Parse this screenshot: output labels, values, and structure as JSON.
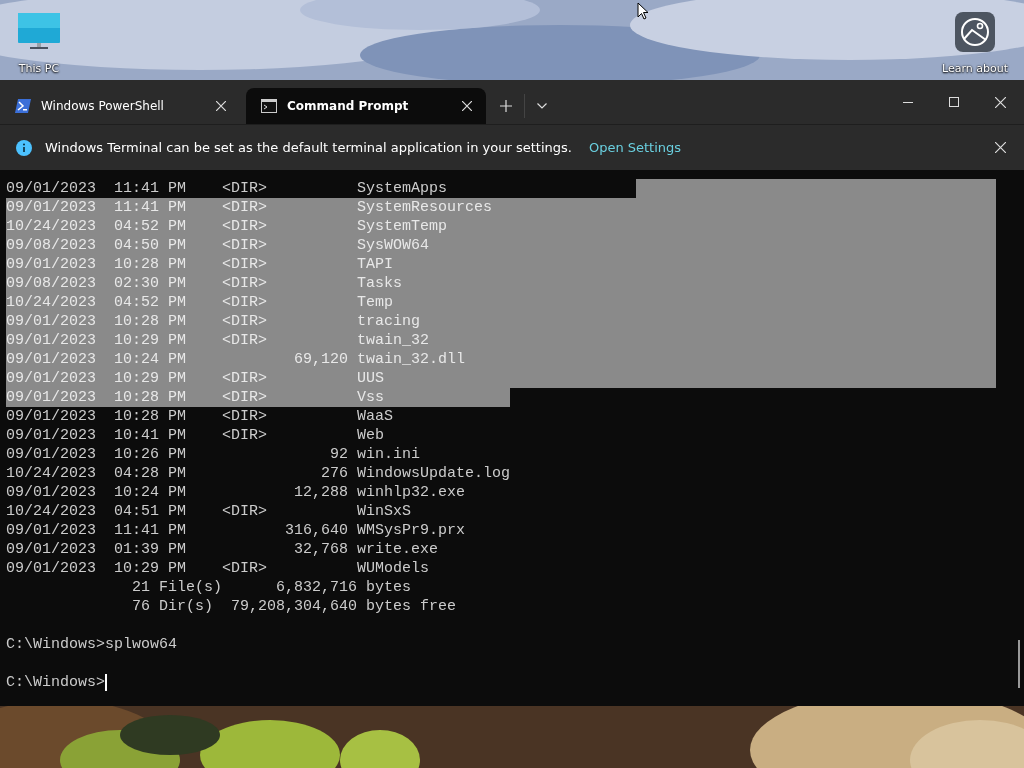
{
  "desktop": {
    "icons": [
      {
        "label": "This PC",
        "kind": "computer"
      },
      {
        "label": "Learn about",
        "kind": "spotlight"
      }
    ]
  },
  "window": {
    "tabs": [
      {
        "title": "Windows PowerShell",
        "kind": "powershell",
        "selected": false
      },
      {
        "title": "Command Prompt",
        "kind": "cmd",
        "selected": true
      }
    ]
  },
  "infobar": {
    "message": "Windows Terminal can be set as the default terminal application in your settings.",
    "link": "Open Settings"
  },
  "terminal": {
    "lines": [
      {
        "text": "09/01/2023  11:41 PM    <DIR>          SystemApps",
        "kind": "tail"
      },
      {
        "text": "09/01/2023  11:41 PM    <DIR>          SystemResources",
        "kind": "full"
      },
      {
        "text": "10/24/2023  04:52 PM    <DIR>          SystemTemp",
        "kind": "full"
      },
      {
        "text": "09/08/2023  04:50 PM    <DIR>          SysWOW64",
        "kind": "full"
      },
      {
        "text": "09/01/2023  10:28 PM    <DIR>          TAPI",
        "kind": "full"
      },
      {
        "text": "09/08/2023  02:30 PM    <DIR>          Tasks",
        "kind": "full"
      },
      {
        "text": "10/24/2023  04:52 PM    <DIR>          Temp",
        "kind": "full"
      },
      {
        "text": "09/01/2023  10:28 PM    <DIR>          tracing",
        "kind": "full"
      },
      {
        "text": "09/01/2023  10:29 PM    <DIR>          twain_32",
        "kind": "full"
      },
      {
        "text": "09/01/2023  10:24 PM            69,120 twain_32.dll",
        "kind": "full"
      },
      {
        "text": "09/01/2023  10:29 PM    <DIR>          UUS",
        "kind": "full"
      },
      {
        "text": "09/01/2023  10:28 PM    <DIR>          Vss",
        "kind": "head"
      },
      {
        "text": "09/01/2023  10:28 PM    <DIR>          WaaS",
        "kind": "plain"
      },
      {
        "text": "09/01/2023  10:41 PM    <DIR>          Web",
        "kind": "plain"
      },
      {
        "text": "09/01/2023  10:26 PM                92 win.ini",
        "kind": "plain"
      },
      {
        "text": "10/24/2023  04:28 PM               276 WindowsUpdate.log",
        "kind": "plain"
      },
      {
        "text": "09/01/2023  10:24 PM            12,288 winhlp32.exe",
        "kind": "plain"
      },
      {
        "text": "10/24/2023  04:51 PM    <DIR>          WinSxS",
        "kind": "plain"
      },
      {
        "text": "09/01/2023  11:41 PM           316,640 WMSysPr9.prx",
        "kind": "plain"
      },
      {
        "text": "09/01/2023  01:39 PM            32,768 write.exe",
        "kind": "plain"
      },
      {
        "text": "09/01/2023  10:29 PM    <DIR>          WUModels",
        "kind": "plain"
      },
      {
        "text": "              21 File(s)      6,832,716 bytes",
        "kind": "plain"
      },
      {
        "text": "              76 Dir(s)  79,208,304,640 bytes free",
        "kind": "plain"
      }
    ],
    "prompts": [
      {
        "text": "C:\\Windows>splwow64",
        "cursor": false
      },
      {
        "text": "C:\\Windows>",
        "cursor": true
      }
    ]
  }
}
